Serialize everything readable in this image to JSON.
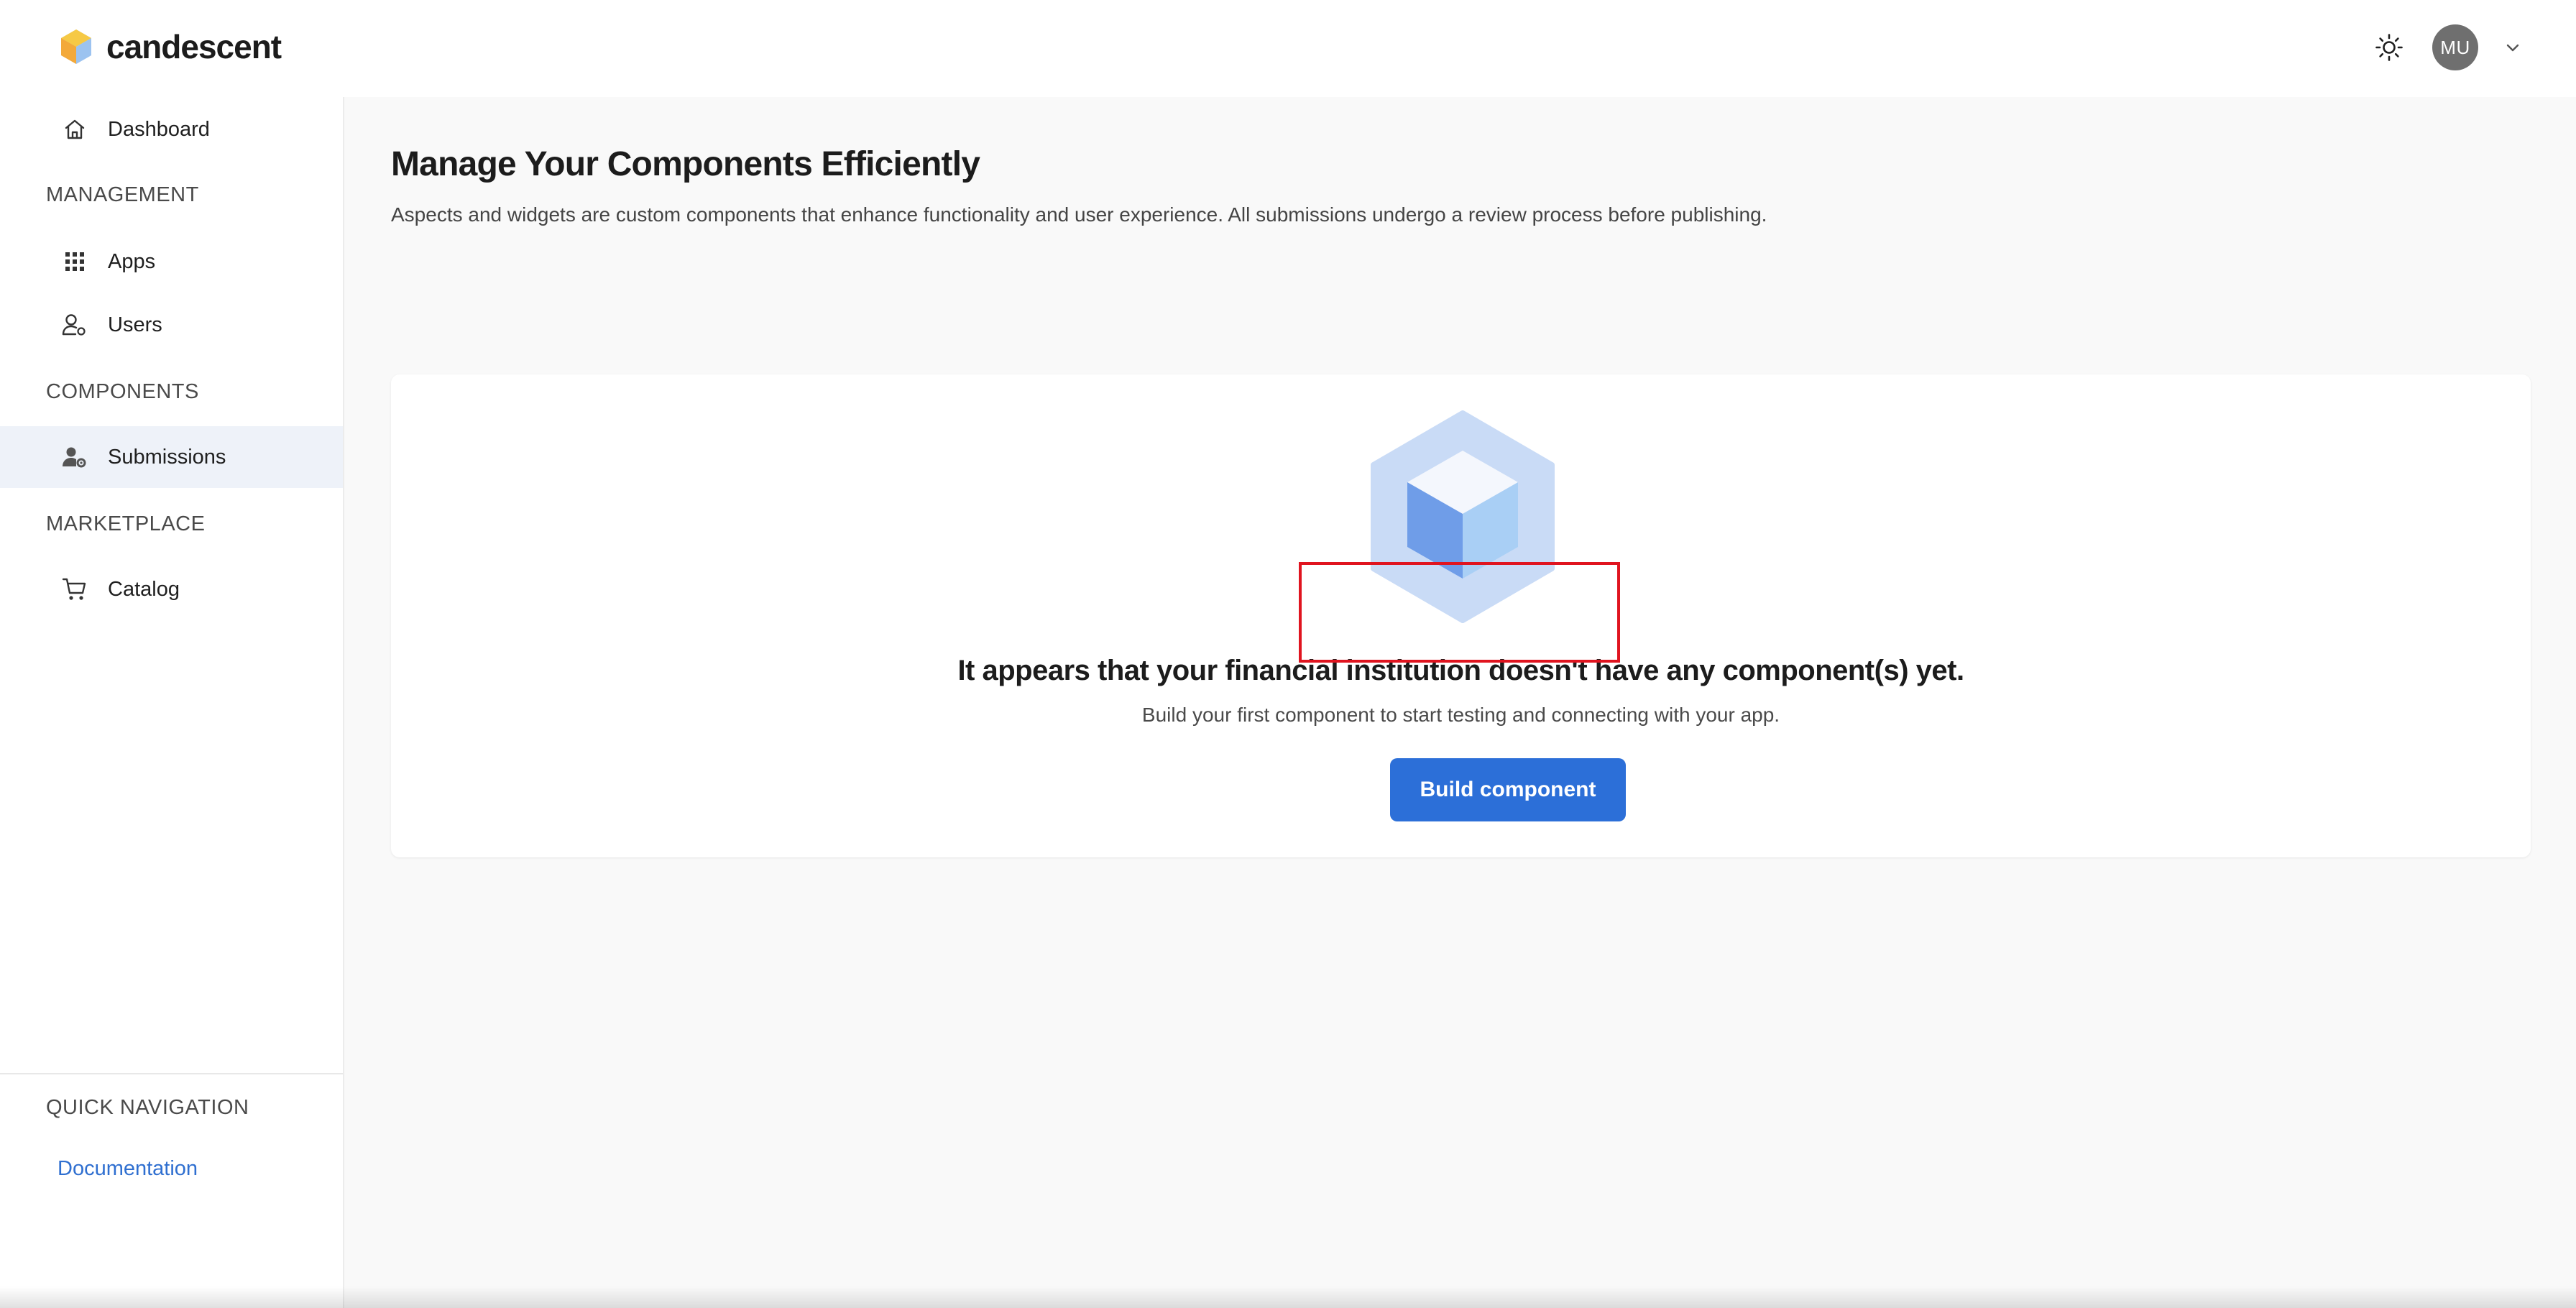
{
  "app": {
    "logo_text": "candescent"
  },
  "header": {
    "avatar_initials": "MU",
    "theme_icon": "sun-icon",
    "menu_icon": "chevron-down-icon"
  },
  "sidebar": {
    "top_items": [
      {
        "label": "Dashboard",
        "icon": "home-icon"
      }
    ],
    "sections": [
      {
        "label": "MANAGEMENT",
        "items": [
          {
            "label": "Apps",
            "icon": "grid-icon"
          },
          {
            "label": "Users",
            "icon": "user-settings-icon"
          }
        ]
      },
      {
        "label": "COMPONENTS",
        "items": [
          {
            "label": "Submissions",
            "icon": "user-gear-icon",
            "active": true
          }
        ]
      },
      {
        "label": "MARKETPLACE",
        "items": [
          {
            "label": "Catalog",
            "icon": "cart-icon"
          }
        ]
      }
    ],
    "quick_nav": {
      "label": "QUICK NAVIGATION",
      "link": "Documentation"
    }
  },
  "main": {
    "title": "Manage Your Components Efficiently",
    "subtitle": "Aspects and widgets are custom components that enhance functionality and user experience. All submissions undergo a review process before publishing.",
    "empty_state": {
      "illustration": "cube-icon",
      "title": "It appears that your financial institution doesn't have any component(s) yet.",
      "subtitle": "Build your first component to start testing and connecting with your app.",
      "button_label": "Build component"
    }
  },
  "colors": {
    "accent": "#2c6fd8",
    "link": "#2f6fd0",
    "active_bg": "#eef2f9",
    "main_bg": "#f9f9f9",
    "highlight": "#e0141f"
  }
}
